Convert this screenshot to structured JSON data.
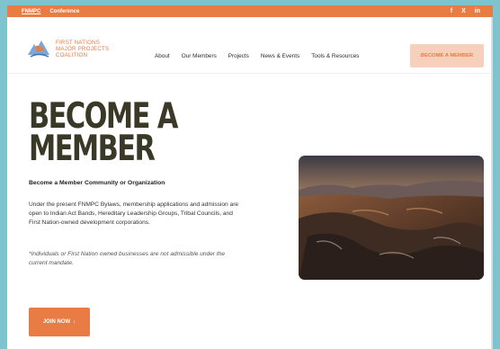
{
  "topbar": {
    "links": [
      "FNMPC",
      "Conference"
    ],
    "social": [
      "f",
      "X",
      "in"
    ]
  },
  "logo": {
    "lines": [
      "FIRST NATIONS",
      "MAJOR PROJECTS",
      "COALITION"
    ]
  },
  "nav": {
    "items": [
      "About",
      "Our Members",
      "Projects",
      "News & Events",
      "Tools & Resources"
    ],
    "cta": "BECOME A MEMBER"
  },
  "hero": {
    "title_line1": "BECOME A",
    "title_line2": "MEMBER",
    "subheading": "Become a Member Community or Organization",
    "body": "Under the present FNMPC Bylaws, membership applications and admission are open to Indian Act Bands, Hereditary Leadership Groups, Tribal Councils, and First Nation-owned development corporations.",
    "note": "*Individuals or First Nation owned businesses are not admissible under the current mandate.",
    "join_label": "JOIN NOW",
    "join_arrow": "↓"
  },
  "colors": {
    "accent": "#e97b45",
    "cta_bg": "#f6d0bb",
    "title": "#3a3826",
    "page_bg": "#7ec4cf"
  }
}
